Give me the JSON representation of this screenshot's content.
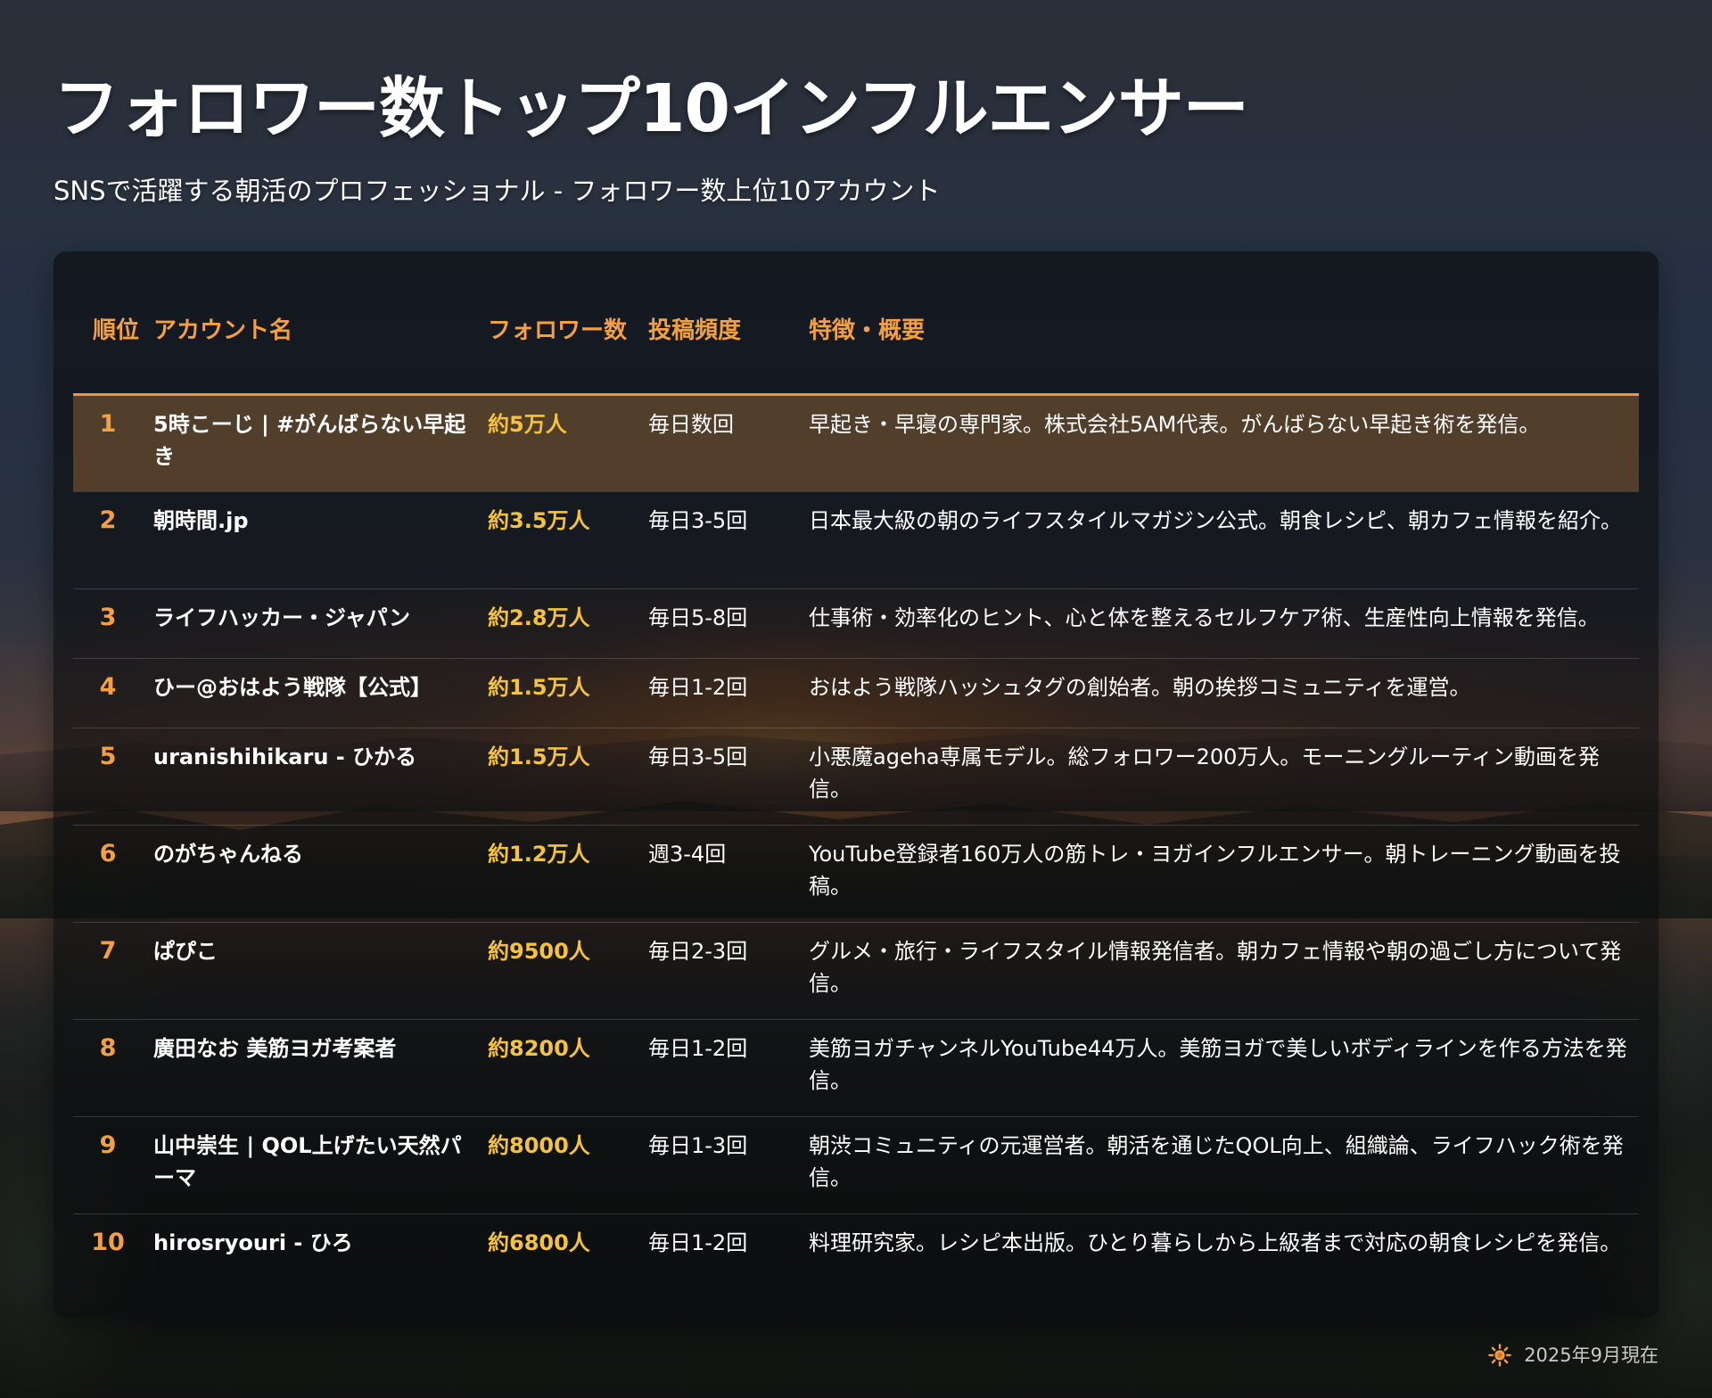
{
  "header": {
    "title": "フォロワー数トップ10インフルエンサー",
    "subtitle": "SNSで活躍する朝活のプロフェッショナル - フォロワー数上位10アカウント"
  },
  "table": {
    "columns": [
      "順位",
      "アカウント名",
      "フォロワー数",
      "投稿頻度",
      "特徴・概要"
    ],
    "rows": [
      {
        "rank": "1",
        "name": "5時こーじ | #がんばらない早起き",
        "followers": "約5万人",
        "frequency": "毎日数回",
        "description": "早起き・早寝の専門家。株式会社5AM代表。がんばらない早起き術を発信。"
      },
      {
        "rank": "2",
        "name": "朝時間.jp",
        "followers": "約3.5万人",
        "frequency": "毎日3-5回",
        "description": "日本最大級の朝のライフスタイルマガジン公式。朝食レシピ、朝カフェ情報を紹介。"
      },
      {
        "rank": "3",
        "name": "ライフハッカー・ジャパン",
        "followers": "約2.8万人",
        "frequency": "毎日5-8回",
        "description": "仕事術・効率化のヒント、心と体を整えるセルフケア術、生産性向上情報を発信。"
      },
      {
        "rank": "4",
        "name": "ひー@おはよう戦隊【公式】",
        "followers": "約1.5万人",
        "frequency": "毎日1-2回",
        "description": "おはよう戦隊ハッシュタグの創始者。朝の挨拶コミュニティを運営。"
      },
      {
        "rank": "5",
        "name": "uranishihikaru - ひかる",
        "followers": "約1.5万人",
        "frequency": "毎日3-5回",
        "description": "小悪魔ageha専属モデル。総フォロワー200万人。モーニングルーティン動画を発信。"
      },
      {
        "rank": "6",
        "name": "のがちゃんねる",
        "followers": "約1.2万人",
        "frequency": "週3-4回",
        "description": "YouTube登録者160万人の筋トレ・ヨガインフルエンサー。朝トレーニング動画を投稿。"
      },
      {
        "rank": "7",
        "name": "ぱぴこ",
        "followers": "約9500人",
        "frequency": "毎日2-3回",
        "description": "グルメ・旅行・ライフスタイル情報発信者。朝カフェ情報や朝の過ごし方について発信。"
      },
      {
        "rank": "8",
        "name": "廣田なお 美筋ヨガ考案者",
        "followers": "約8200人",
        "frequency": "毎日1-2回",
        "description": "美筋ヨガチャンネルYouTube44万人。美筋ヨガで美しいボディラインを作る方法を発信。"
      },
      {
        "rank": "9",
        "name": "山中崇生 | QOL上げたい天然パーマ",
        "followers": "約8000人",
        "frequency": "毎日1-3回",
        "description": "朝渋コミュニティの元運営者。朝活を通じたQOL向上、組織論、ライフハック術を発信。"
      },
      {
        "rank": "10",
        "name": "hirosryouri - ひろ",
        "followers": "約6800人",
        "frequency": "毎日1-2回",
        "description": "料理研究家。レシピ本出版。ひとり暮らしから上級者まで対応の朝食レシピを発信。"
      }
    ]
  },
  "footer": {
    "icon": "sun-icon",
    "date": "2025年9月現在"
  },
  "colors": {
    "accent_orange": "#f4a040",
    "follower_yellow": "#f5c33a",
    "highlight_row": "#78552f"
  }
}
